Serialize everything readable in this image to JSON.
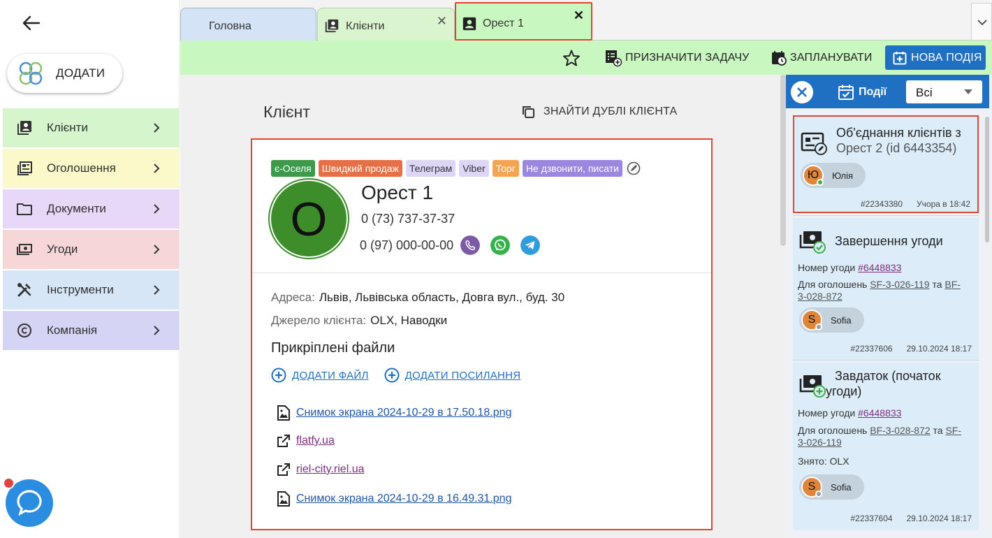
{
  "sidebar": {
    "add_label": "ДОДАТИ",
    "items": [
      {
        "label": "Клієнти",
        "color": "#d5f5cc"
      },
      {
        "label": "Оголошення",
        "color": "#fbf9c9"
      },
      {
        "label": "Документи",
        "color": "#e6d8f6"
      },
      {
        "label": "Угоди",
        "color": "#f6d6d6"
      },
      {
        "label": "Інструменти",
        "color": "#d7e6f7"
      },
      {
        "label": "Компанія",
        "color": "#d5d4f5"
      }
    ]
  },
  "tabs": {
    "main": "Головна",
    "clients": "Клієнти",
    "active": "Орест 1"
  },
  "toolbar": {
    "assign_task": "ПРИЗНАЧИТИ ЗАДАЧУ",
    "schedule": "ЗАПЛАНУВАТИ",
    "new_event": "НОВА ПОДІЯ"
  },
  "main": {
    "title": "Клієнт",
    "find_duplicates": "ЗНАЙТИ ДУБЛІ КЛІЄНТА"
  },
  "client": {
    "tags": [
      {
        "label": "є-Оселя",
        "bg": "#3d9a4b",
        "fg": "#ffffff"
      },
      {
        "label": "Швидкий продаж",
        "bg": "#e76f45",
        "fg": "#ffffff"
      },
      {
        "label": "Телеграм",
        "bg": "#ddd6f7",
        "fg": "#333333"
      },
      {
        "label": "Viber",
        "bg": "#ddd6f7",
        "fg": "#333333"
      },
      {
        "label": "Торг",
        "bg": "#f5a552",
        "fg": "#ffffff"
      },
      {
        "label": "Не дзвонити, писати",
        "bg": "#9b86e0",
        "fg": "#ffffff"
      }
    ],
    "avatar_letter": "О",
    "name": "Орест 1",
    "phone1": "0 (73) 737-37-37",
    "phone2": "0 (97) 000-00-00",
    "address_label": "Адреса:",
    "address": "Львів, Львівська область, Довга вул., буд. 30",
    "source_label": "Джерело клієнта:",
    "source": "OLX, Наводки",
    "files_title": "Прикріплені файли",
    "add_file": "ДОДАТИ ФАЙЛ",
    "add_link": "ДОДАТИ ПОСИЛАННЯ",
    "files": [
      {
        "name": "Снимок экрана 2024-10-29 в 17.50.18.png",
        "kind": "image",
        "color": "#1f56a8"
      },
      {
        "name": "flatfy.ua",
        "kind": "link",
        "color": "#7b2f7f"
      },
      {
        "name": "riel-city.riel.ua",
        "kind": "link",
        "color": "#7b2f7f"
      },
      {
        "name": "Снимок экрана 2024-10-29 в 16.49.31.png",
        "kind": "image",
        "color": "#1f56a8"
      }
    ]
  },
  "events": {
    "title": "Події",
    "filter": "Всі",
    "cards": [
      {
        "title": "Об'єднання клієнтів з",
        "subtitle": "Орест 2 (id 6443354)",
        "user_initial": "Ю",
        "user_name": "Юлія",
        "user_status_color": "#3fae49",
        "id": "#22343380",
        "time": "Учора в 18:42"
      },
      {
        "title": "Завершення угоди",
        "deal_label": "Номер угоди",
        "deal": "#6448833",
        "ads_label": "Для оголошень",
        "ad1": "SF-3-026-119",
        "and": "та",
        "ad2_a": "BF-",
        "ad2_b": "3-028-872",
        "user_initial": "S",
        "user_name": "Sofia",
        "user_status_color": "#9e9e9e",
        "id": "#22337606",
        "time": "29.10.2024 18:17"
      },
      {
        "title_a": "Завдаток (початок",
        "title_b": "угоди)",
        "deal_label": "Номер угоди",
        "deal": "#6448833",
        "ads_label": "Для оголошень",
        "ad1": "BF-3-028-872",
        "and": "та",
        "ad2_a": "SF-",
        "ad2_b": "3-026-119",
        "removed": "Знято: OLX",
        "user_initial": "S",
        "user_name": "Sofia",
        "user_status_color": "#9e9e9e",
        "id": "#22337604",
        "time": "29.10.2024 18:17"
      }
    ]
  },
  "icons": [
    "back-arrow-icon",
    "logo-icon",
    "clients-icon",
    "ads-icon",
    "folder-icon",
    "money-icon",
    "tools-icon",
    "copyright-icon",
    "chevron-right-icon",
    "chat-icon",
    "close-icon",
    "chevron-down-icon",
    "star-icon",
    "assign-task-icon",
    "calendar-clock-icon",
    "calendar-plus-icon",
    "copy-icon",
    "edit-icon",
    "viber-icon",
    "whatsapp-icon",
    "telegram-icon",
    "add-circle-icon",
    "image-file-icon",
    "external-link-icon",
    "calendar-check-icon",
    "merge-icon",
    "deal-done-icon",
    "deal-deposit-icon"
  ]
}
